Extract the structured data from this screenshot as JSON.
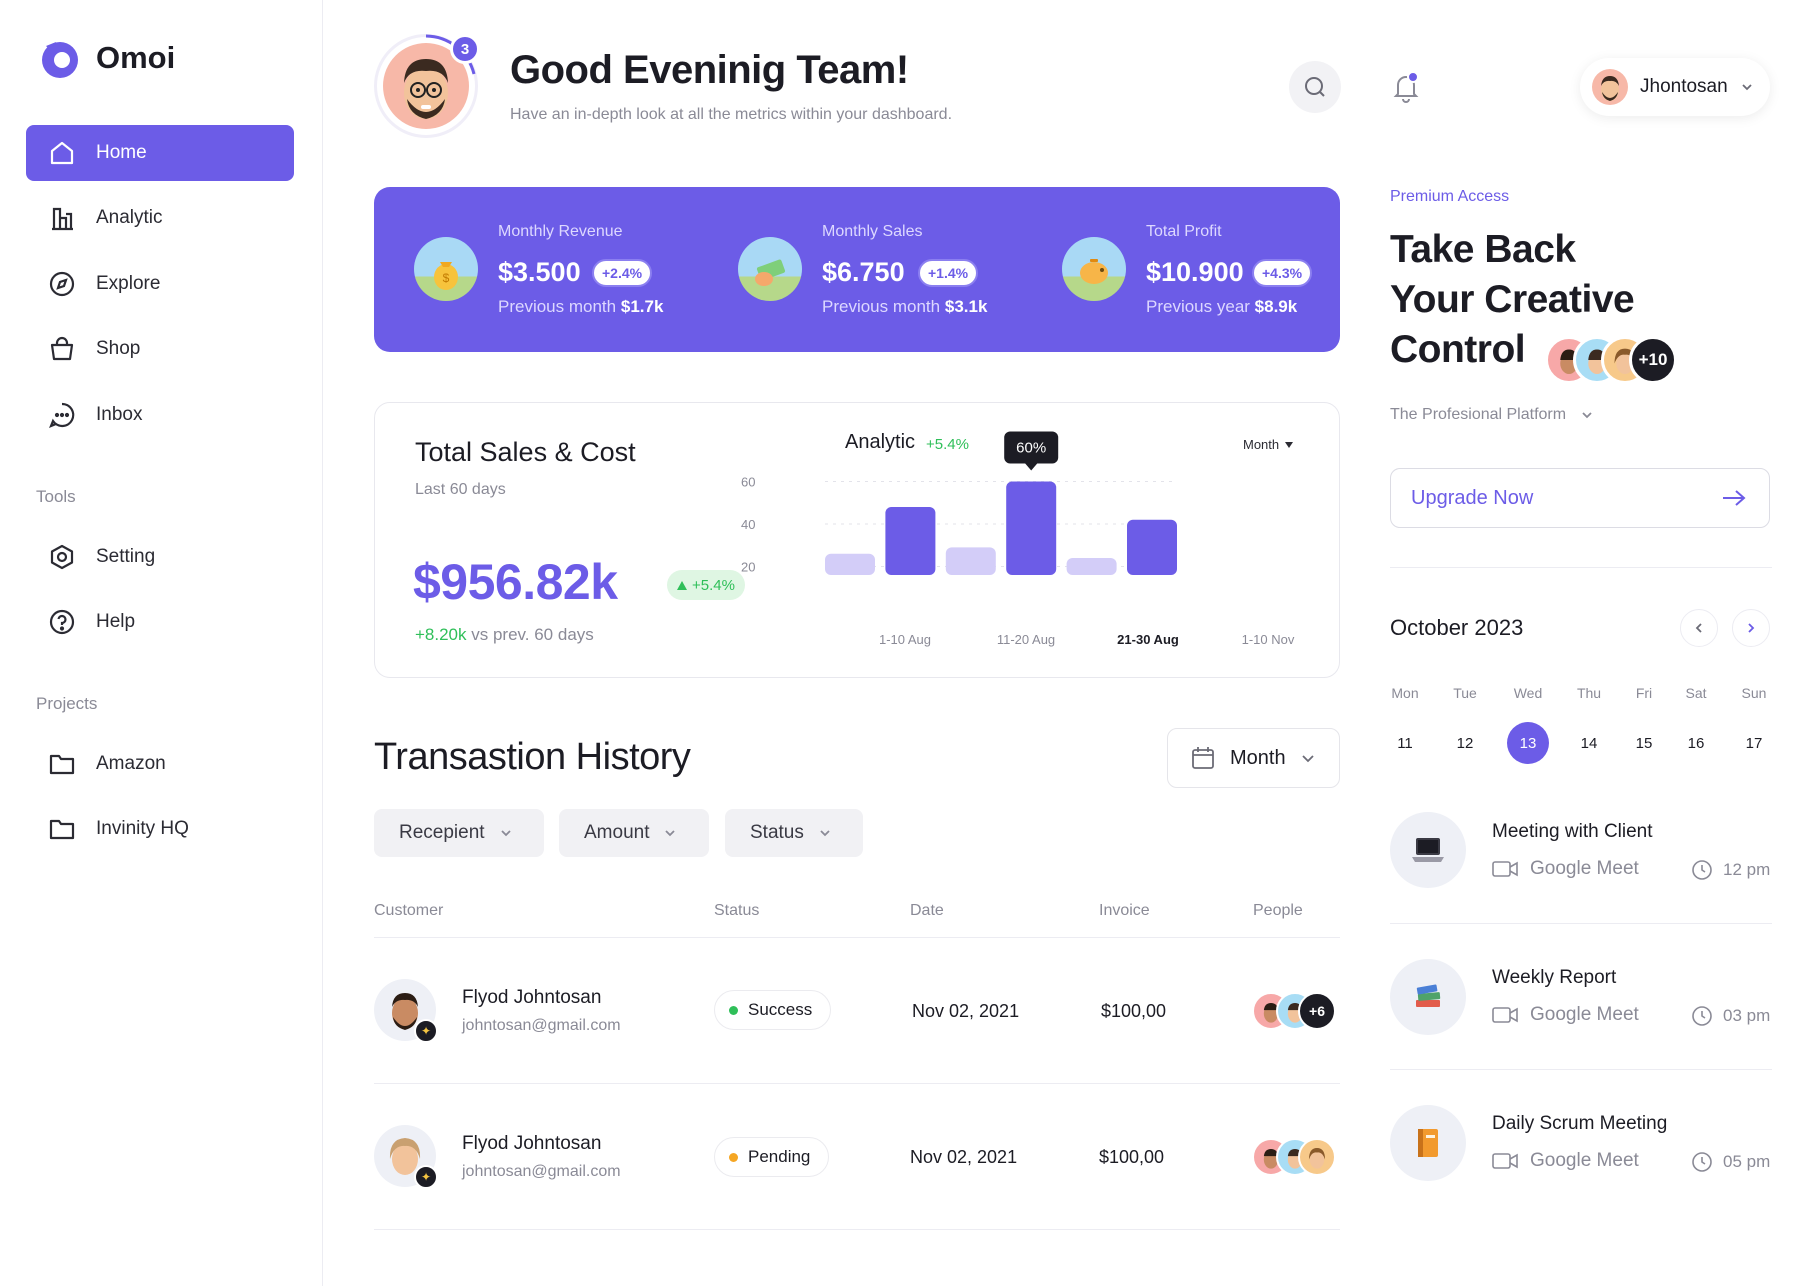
{
  "brand": {
    "name": "Omoi",
    "accent": "#6c5ce7"
  },
  "sidebar": {
    "items": [
      {
        "label": "Home",
        "icon": "home-icon",
        "active": true
      },
      {
        "label": "Analytic",
        "icon": "bar-chart-icon"
      },
      {
        "label": "Explore",
        "icon": "compass-icon"
      },
      {
        "label": "Shop",
        "icon": "shopping-bag-icon"
      },
      {
        "label": "Inbox",
        "icon": "chat-bubble-icon"
      }
    ],
    "tools_label": "Tools",
    "tools": [
      {
        "label": "Setting",
        "icon": "hexagon-settings-icon"
      },
      {
        "label": "Help",
        "icon": "help-circle-icon"
      }
    ],
    "projects_label": "Projects",
    "projects": [
      {
        "label": "Amazon",
        "icon": "folder-icon"
      },
      {
        "label": "Invinity HQ",
        "icon": "folder-icon"
      }
    ]
  },
  "header": {
    "title": "Good Eveninig Team!",
    "subtitle": "Have an in-depth look at all the metrics within your dashboard.",
    "notification_count": "3",
    "user_name": "Jhontosan"
  },
  "kpis": [
    {
      "label": "Monthly Revenue",
      "value": "$3.500",
      "change": "+2.4%",
      "prev_label": "Previous month",
      "prev_value": "$1.7k"
    },
    {
      "label": "Monthly Sales",
      "value": "$6.750",
      "change": "+1.4%",
      "prev_label": "Previous month",
      "prev_value": "$3.1k"
    },
    {
      "label": "Total Profit",
      "value": "$10.900",
      "change": "+4.3%",
      "prev_label": "Previous year",
      "prev_value": "$8.9k"
    }
  ],
  "sales": {
    "title": "Total Sales & Cost",
    "period": "Last 60 days",
    "value": "$956.82k",
    "change": "+5.4%",
    "delta": "+8.20k",
    "delta_suffix": "vs prev. 60 days"
  },
  "chart_data": {
    "type": "bar",
    "title": "Analytic",
    "change": "+5.4%",
    "period_select": "Month",
    "categories": [
      "1-10 Aug",
      "",
      "11-20 Aug",
      "",
      "21-30 Aug",
      "",
      "1-10 Nov"
    ],
    "values": [
      26,
      48,
      29,
      60,
      24,
      42
    ],
    "x_tick_labels": [
      "1-10 Aug",
      "11-20 Aug",
      "21-30 Aug",
      "1-10 Nov"
    ],
    "y_ticks": [
      20,
      40,
      60
    ],
    "ylim": [
      16,
      64
    ],
    "highlight_index": 3,
    "highlight_label": "60%",
    "grid": true
  },
  "transactions": {
    "title": "Transastion History",
    "period": "Month",
    "filters": [
      "Recepient",
      "Amount",
      "Status"
    ],
    "columns": [
      "Customer",
      "Status",
      "Date",
      "Invoice",
      "People"
    ],
    "rows": [
      {
        "name": "Flyod Johntosan",
        "email": "johntosan@gmail.com",
        "status": "Success",
        "status_color": "#2fbf59",
        "date": "Nov 02, 2021",
        "invoice": "$100,00",
        "people_extra": "+6"
      },
      {
        "name": "Flyod Johntosan",
        "email": "johntosan@gmail.com",
        "status": "Pending",
        "status_color": "#f5a623",
        "date": "Nov 02, 2021",
        "invoice": "$100,00",
        "people_extra": ""
      }
    ]
  },
  "promo": {
    "eyebrow": "Premium Access",
    "line1": "Take Back",
    "line2": "Your Creative",
    "line3": "Control",
    "members_extra": "+10",
    "platform": "The Profesional Platform",
    "cta": "Upgrade Now"
  },
  "calendar": {
    "title": "October 2023",
    "weekdays": [
      "Mon",
      "Tue",
      "Wed",
      "Thu",
      "Fri",
      "Sat",
      "Sun"
    ],
    "days": [
      "11",
      "12",
      "13",
      "14",
      "15",
      "16",
      "17"
    ],
    "selected": "13"
  },
  "events": [
    {
      "title": "Meeting with Client",
      "where": "Google Meet",
      "time": "12 pm",
      "icon": "laptop-icon"
    },
    {
      "title": "Weekly Report",
      "where": "Google Meet",
      "time": "03 pm",
      "icon": "books-icon"
    },
    {
      "title": "Daily Scrum Meeting",
      "where": "Google Meet",
      "time": "05 pm",
      "icon": "notebook-icon"
    }
  ]
}
